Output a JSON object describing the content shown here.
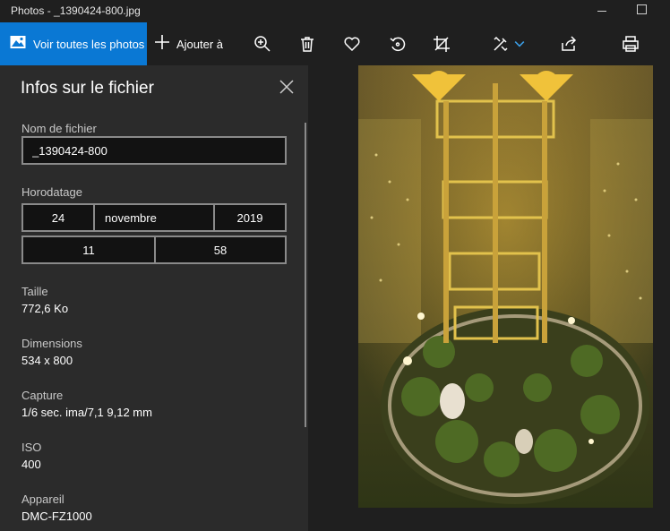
{
  "window": {
    "title": "Photos - _1390424-800.jpg"
  },
  "toolbar": {
    "view_all_label": "Voir toutes les photos",
    "add_label": "Ajouter à",
    "icons": [
      "photos-icon",
      "plus-icon",
      "zoom-in-icon",
      "delete-icon",
      "favorite-icon",
      "rotate-icon",
      "crop-icon",
      "edit-icon",
      "chevron-down-icon",
      "share-icon",
      "print-icon"
    ]
  },
  "panel": {
    "title": "Infos sur le fichier",
    "filename_label": "Nom de fichier",
    "filename_value": "_1390424-800",
    "timestamp_label": "Horodatage",
    "date": {
      "day": "24",
      "month": "novembre",
      "year": "2019"
    },
    "time": {
      "hour": "11",
      "minute": "58"
    },
    "size_label": "Taille",
    "size_value": "772,6 Ko",
    "dimensions_label": "Dimensions",
    "dimensions_value": "534 x 800",
    "capture_label": "Capture",
    "capture_value": "1/6 sec. ima/7,1 9,12 mm",
    "iso_label": "ISO",
    "iso_value": "400",
    "device_label": "Appareil",
    "device_value": "DMC-FZ1000"
  },
  "colors": {
    "accent": "#0a78d4",
    "panel_bg": "#2b2b2b",
    "app_bg": "#1f1f1f",
    "input_border": "#8a8a8a"
  }
}
